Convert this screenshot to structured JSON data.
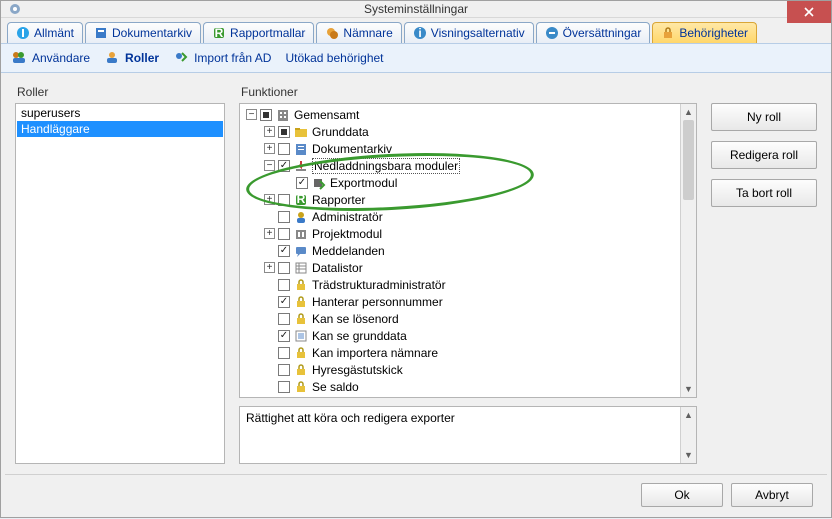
{
  "window": {
    "title": "Systeminställningar"
  },
  "tabs": [
    {
      "label": "Allmänt"
    },
    {
      "label": "Dokumentarkiv"
    },
    {
      "label": "Rapportmallar"
    },
    {
      "label": "Nämnare"
    },
    {
      "label": "Visningsalternativ"
    },
    {
      "label": "Översättningar"
    },
    {
      "label": "Behörigheter",
      "active": true
    }
  ],
  "toolbar": [
    {
      "label": "Användare"
    },
    {
      "label": "Roller",
      "active": true
    },
    {
      "label": "Import från AD"
    },
    {
      "label": "Utökad behörighet"
    }
  ],
  "roles": {
    "label": "Roller",
    "items": [
      "superusers",
      "Handläggare"
    ],
    "selectedIndex": 1
  },
  "functions": {
    "label": "Funktioner",
    "tree": [
      {
        "depth": 0,
        "expander": "-",
        "check": "tri",
        "icon": "building",
        "label": "Gemensamt"
      },
      {
        "depth": 1,
        "expander": "+",
        "check": "tri",
        "icon": "folder",
        "label": "Grunddata"
      },
      {
        "depth": 1,
        "expander": "+",
        "check": "off",
        "icon": "archive",
        "label": "Dokumentarkiv"
      },
      {
        "depth": 1,
        "expander": "-",
        "check": "on",
        "icon": "download",
        "label": "Nedladdningsbara moduler",
        "selected": true
      },
      {
        "depth": 2,
        "expander": "",
        "check": "on",
        "icon": "export",
        "label": "Exportmodul"
      },
      {
        "depth": 1,
        "expander": "+",
        "check": "off",
        "icon": "report",
        "label": "Rapporter"
      },
      {
        "depth": 1,
        "expander": "",
        "check": "off",
        "icon": "user",
        "label": "Administratör"
      },
      {
        "depth": 1,
        "expander": "+",
        "check": "off",
        "icon": "project",
        "label": "Projektmodul"
      },
      {
        "depth": 1,
        "expander": "",
        "check": "on",
        "icon": "message",
        "label": "Meddelanden"
      },
      {
        "depth": 1,
        "expander": "+",
        "check": "off",
        "icon": "datalist",
        "label": "Datalistor"
      },
      {
        "depth": 1,
        "expander": "",
        "check": "off",
        "icon": "lock",
        "label": "Trädstrukturadministratör"
      },
      {
        "depth": 1,
        "expander": "",
        "check": "on",
        "icon": "lock",
        "label": "Hanterar personnummer"
      },
      {
        "depth": 1,
        "expander": "",
        "check": "off",
        "icon": "lock",
        "label": "Kan se lösenord"
      },
      {
        "depth": 1,
        "expander": "",
        "check": "on",
        "icon": "list",
        "label": "Kan se grunddata"
      },
      {
        "depth": 1,
        "expander": "",
        "check": "off",
        "icon": "lock",
        "label": "Kan importera nämnare"
      },
      {
        "depth": 1,
        "expander": "",
        "check": "off",
        "icon": "lock",
        "label": "Hyresgästutskick"
      },
      {
        "depth": 1,
        "expander": "",
        "check": "off",
        "icon": "lock",
        "label": "Se saldo"
      }
    ]
  },
  "description": "Rättighet att köra och redigera exporter",
  "sideButtons": {
    "new": "Ny roll",
    "edit": "Redigera roll",
    "delete": "Ta bort roll"
  },
  "footer": {
    "ok": "Ok",
    "cancel": "Avbryt"
  }
}
